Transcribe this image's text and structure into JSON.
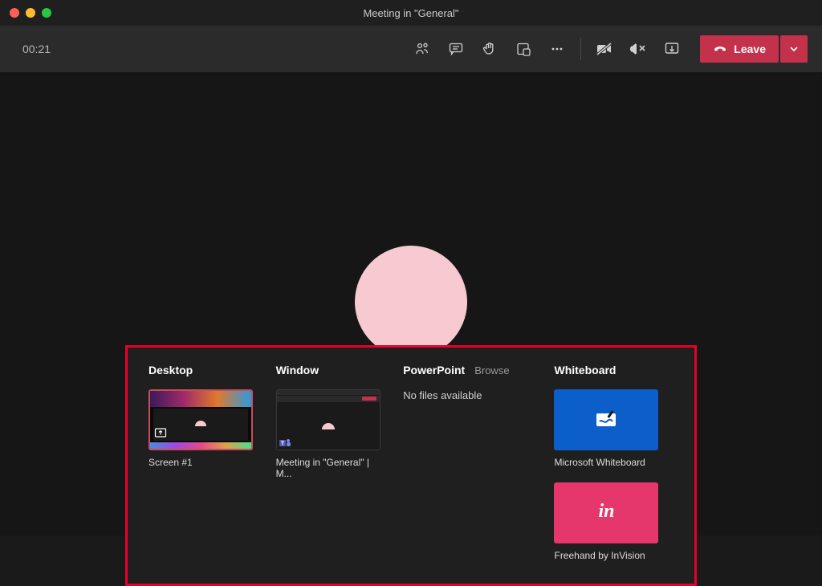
{
  "titlebar": {
    "title": "Meeting in \"General\""
  },
  "toolbar": {
    "timer": "00:21",
    "leave_label": "Leave"
  },
  "share": {
    "desktop": {
      "heading": "Desktop",
      "item_caption": "Screen #1"
    },
    "window": {
      "heading": "Window",
      "item_caption": "Meeting in \"General\" | M..."
    },
    "powerpoint": {
      "heading": "PowerPoint",
      "browse_label": "Browse",
      "no_files": "No files available"
    },
    "whiteboard": {
      "heading": "Whiteboard",
      "ms_caption": "Microsoft Whiteboard",
      "invision_caption": "Freehand by InVision",
      "invision_glyph": "in"
    }
  },
  "colors": {
    "accent": "#c4314b",
    "highlight": "#e8002b"
  }
}
